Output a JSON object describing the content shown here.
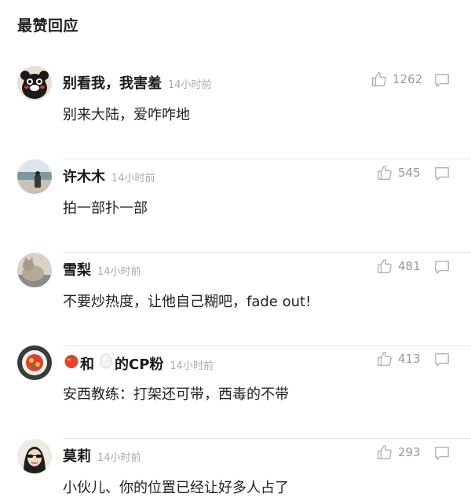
{
  "section": {
    "title": "最赞回应"
  },
  "comments": [
    {
      "username": "别看我，我害羞",
      "time": "14小时前",
      "text": "别来大陆，爱咋咋地",
      "likes": "1262",
      "avatar": "bear-mascot-avatar"
    },
    {
      "username": "许木木",
      "time": "14小时前",
      "text": "拍一部扑一部",
      "likes": "545",
      "avatar": "seaside-photo-avatar"
    },
    {
      "username": "雪梨",
      "time": "14小时前",
      "text": "不要炒热度，让他自己糊吧，fade out!",
      "likes": "481",
      "avatar": "cat-photo-avatar"
    },
    {
      "username_part1": "和",
      "username_part2": "的CP粉",
      "time": "14小时前",
      "text": "安西教练：打架还可带，西毒的不带",
      "likes": "413",
      "avatar": "food-plate-avatar",
      "emoji1": "tomato-icon",
      "emoji2": "egg-icon"
    },
    {
      "username": "莫莉",
      "time": "14小时前",
      "text": "小伙儿、你的位置已经让好多人占了",
      "likes": "293",
      "avatar": "sunglasses-woman-avatar"
    }
  ],
  "colors": {
    "text": "#222222",
    "muted": "#aaaaaa",
    "divider": "#e8e8e8",
    "icon": "#b0b0b0"
  }
}
